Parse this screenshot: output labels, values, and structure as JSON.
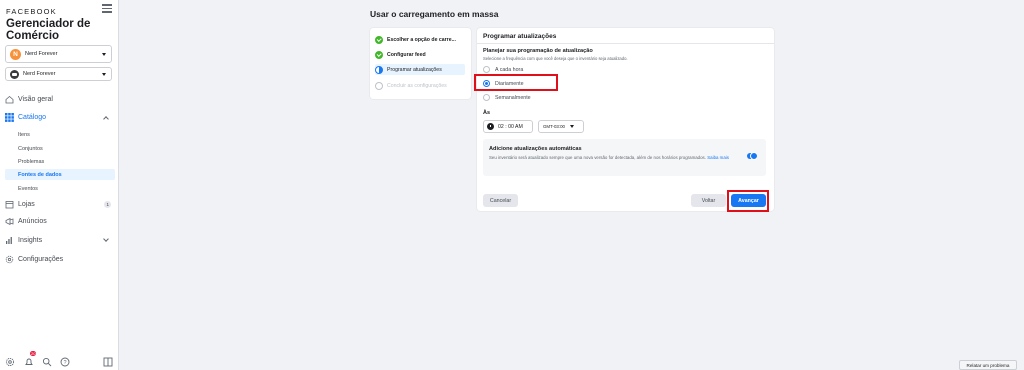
{
  "sidebar": {
    "brand": "FACEBOOK",
    "app_title": "Gerenciador de Comércio",
    "account_selector": {
      "initial": "N",
      "value": "Nerd Forever"
    },
    "page_selector": {
      "value": "Nerd Forever"
    },
    "nav": {
      "overview": "Visão geral",
      "catalog": "Catálogo",
      "catalog_items": [
        "Itens",
        "Conjuntos",
        "Problemas",
        "Fontes de dados",
        "Eventos"
      ],
      "stores": "Lojas",
      "stores_count": "1",
      "ads": "Anúncios",
      "insights": "Insights",
      "settings": "Configurações"
    },
    "bottom": {
      "notification_count": "20"
    }
  },
  "main": {
    "title": "Usar o carregamento em massa",
    "steps": [
      {
        "label": "Escolher a opção de carre...",
        "state": "done"
      },
      {
        "label": "Configurar feed",
        "state": "done"
      },
      {
        "label": "Programar atualizações",
        "state": "active"
      },
      {
        "label": "Concluir as configurações",
        "state": "pending"
      }
    ],
    "form": {
      "title": "Programar atualizações",
      "heading": "Planejar sua programação de atualização",
      "subheading": "Selecione a frequência com que você deseja que o inventário seja atualizado.",
      "frequency_options": [
        "A cada hora",
        "Diariamente",
        "Semanalmente"
      ],
      "selected_frequency": "Diariamente",
      "time_label": "Às",
      "time_value": "02 : 00 AM",
      "timezone": "GMT-03:00",
      "auto_updates": {
        "title": "Adicione atualizações automáticas",
        "description": "Seu inventário será atualizado sempre que uma nova versão for detectada, além de nos horários programados.",
        "link": "Saiba mais",
        "enabled": true
      },
      "buttons": {
        "cancel": "Cancelar",
        "back": "Voltar",
        "next": "Avançar"
      }
    },
    "report_button": "Relatar um problema"
  },
  "colors": {
    "accent": "#1877f2",
    "highlight": "#e0101a",
    "success": "#42b72a"
  }
}
